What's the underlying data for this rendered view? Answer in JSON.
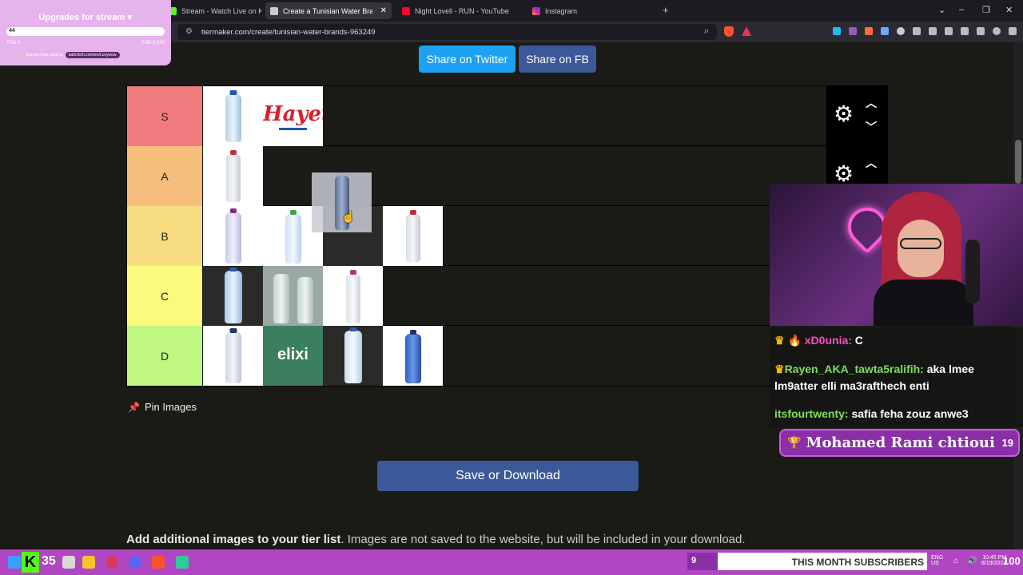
{
  "browser": {
    "tabs": [
      {
        "title": "Stream - Watch Live on Kick",
        "active": false
      },
      {
        "title": "Create a Tunisian Water Brands T",
        "active": true
      },
      {
        "title": "Night Lovell - RUN - YouTube",
        "active": false
      },
      {
        "title": "Instagram",
        "active": false
      }
    ],
    "new_tab": "+",
    "url": "tiermaker.com/create/tunisian-water-brands-963249",
    "window_controls": {
      "menu": "⌄",
      "minimize": "–",
      "restore": "❐",
      "close": "✕"
    }
  },
  "page": {
    "share_twitter": "Share on Twitter",
    "share_fb": "Share on FB",
    "tiers": [
      {
        "label": "S",
        "color": "#f07c80",
        "items": 2
      },
      {
        "label": "A",
        "color": "#f6be7d",
        "items": 1
      },
      {
        "label": "B",
        "color": "#f7dd80",
        "items": 4
      },
      {
        "label": "C",
        "color": "#fbfa7e",
        "items": 3
      },
      {
        "label": "D",
        "color": "#c0f781",
        "items": 4
      }
    ],
    "brand_hayet": "Hayet",
    "brand_elixir": "elixi",
    "pin_images": "Pin Images",
    "save_download": "Save or Download",
    "add_images_bold": "Add additional images to your tier list",
    "add_images_rest": ". Images are not saved to the website, but will be included in your download."
  },
  "stream": {
    "goal_title": "Upgrades for stream ♥",
    "goal_count": "44",
    "goal_min": "TND 0",
    "goal_max": "TND 5,000",
    "goal_support": "Support the goal at",
    "goal_link": "ba9chich.com/en/Lucywow",
    "chat": [
      {
        "user": "xD0unia:",
        "message": "C"
      },
      {
        "user": "Rayen_AKA_tawta5ralifih:",
        "message": "aka lmee lm9atter elli ma3rafthech enti"
      },
      {
        "user": "itsfourtwenty:",
        "message": "safia feha zouz anwe3"
      }
    ],
    "top_donor": "Mohamed Rami chtioui",
    "top_donor_count": "19",
    "kick_count": "35",
    "subs_count": "9",
    "subs_label": "THIS MONTH SUBSCRIBERS",
    "battery": "100",
    "tray_lang": "ENG",
    "tray_region": "US",
    "tray_time": "10:45 PM",
    "tray_date": "8/19/2024"
  }
}
